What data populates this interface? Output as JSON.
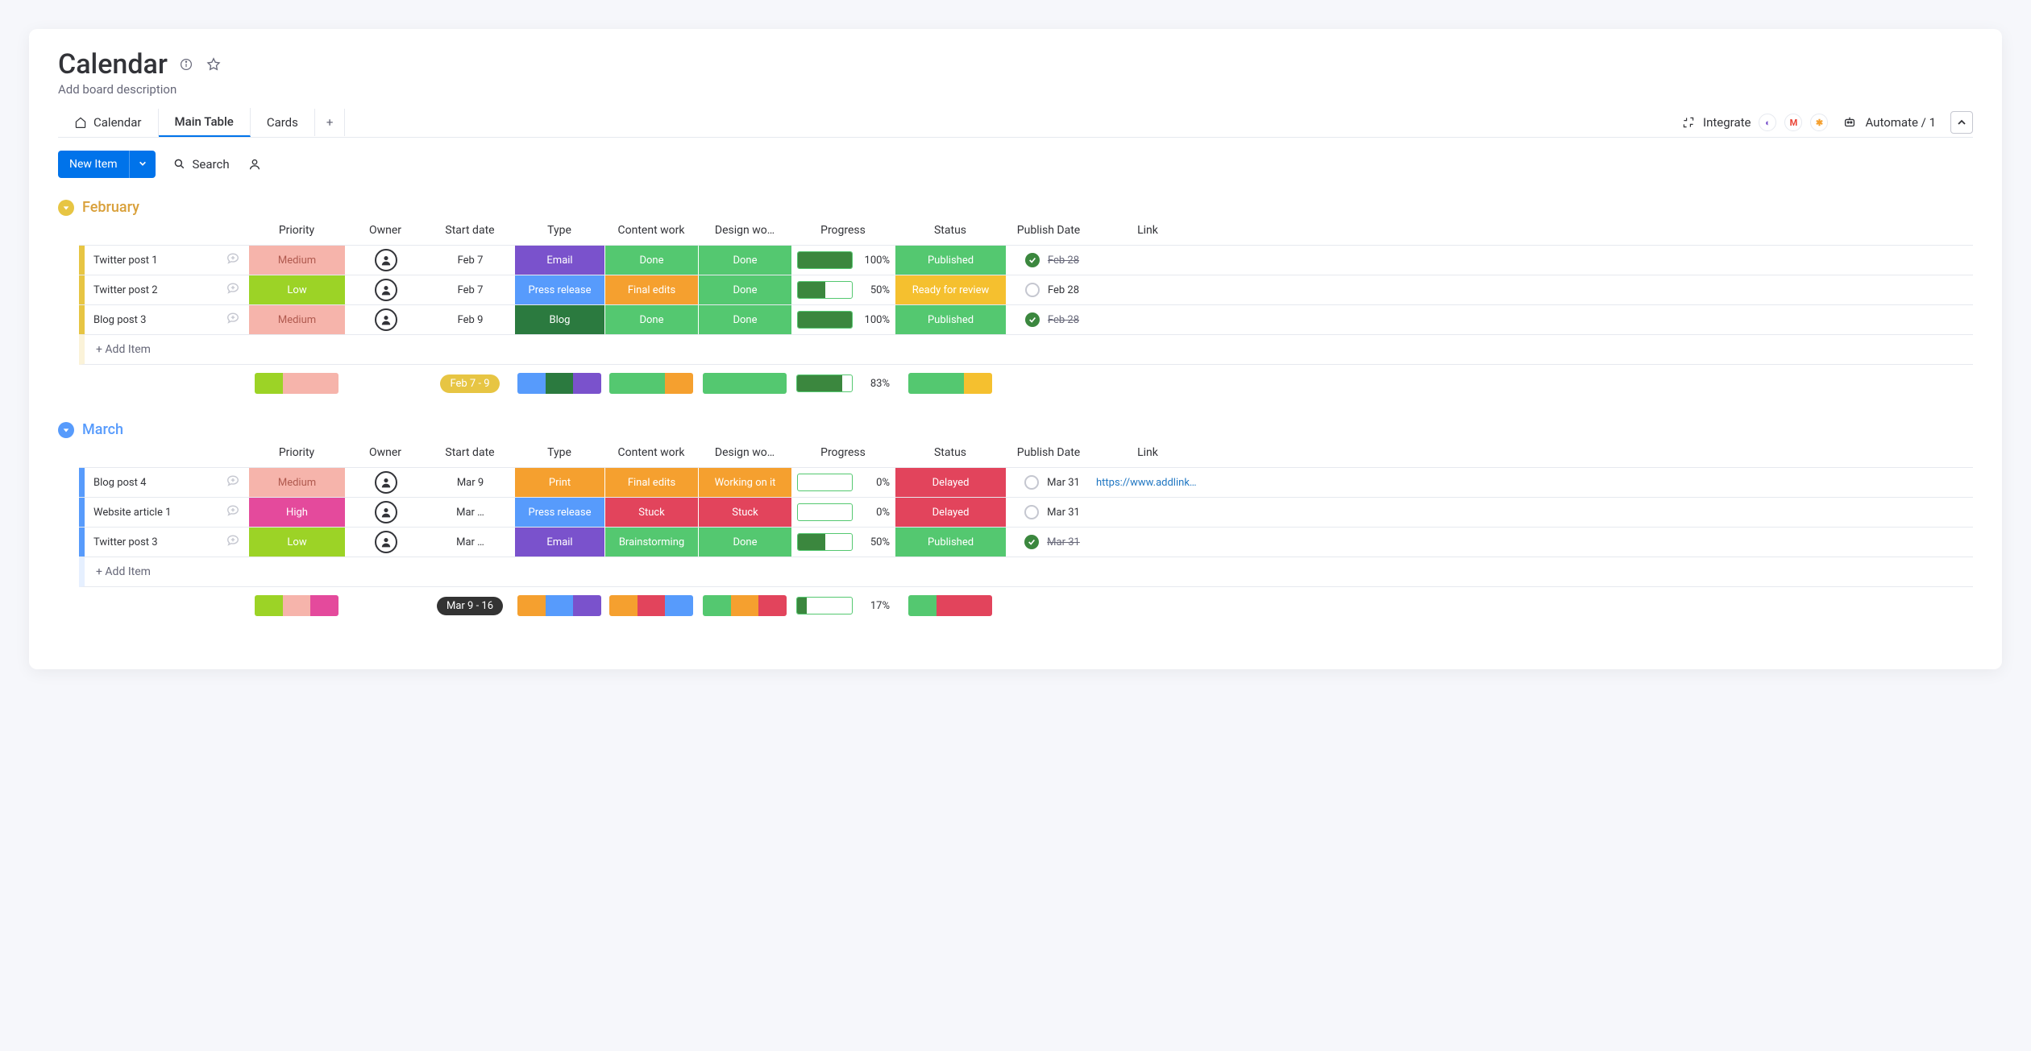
{
  "title": "Calendar",
  "description_placeholder": "Add board description",
  "tabs": {
    "calendar": "Calendar",
    "main_table": "Main Table",
    "cards": "Cards"
  },
  "integrate_label": "Integrate",
  "automate_label": "Automate / 1",
  "new_item_label": "New Item",
  "search_label": "Search",
  "add_item_label": "+ Add Item",
  "columns": {
    "priority": "Priority",
    "owner": "Owner",
    "start_date": "Start date",
    "type": "Type",
    "content_work": "Content work",
    "design_work": "Design wo…",
    "progress": "Progress",
    "status": "Status",
    "publish_date": "Publish Date",
    "link": "Link"
  },
  "colors": {
    "medium": "#f6b4ab",
    "low": "#9cd326",
    "high": "#e44a9c",
    "email": "#7a52cc",
    "press_release": "#579bfc",
    "blog": "#2b7a3f",
    "print": "#f5a02f",
    "done": "#54c870",
    "final_edits": "#f5a02f",
    "stuck": "#e2445c",
    "working": "#f5a02f",
    "brainstorm": "#54c870",
    "published": "#54c870",
    "ready": "#f5c02f",
    "delayed": "#e2445c",
    "feb_stripe": "#e7c543",
    "feb_title": "#d9a03a",
    "mar_stripe": "#579bfc",
    "mar_title": "#579bfc",
    "check_done": "#3b873e",
    "check_pending": "#c5c7d0"
  },
  "groups": [
    {
      "id": "feb",
      "name": "February",
      "summary": {
        "date_range": "Feb 7 - 9",
        "progress": "83%"
      },
      "rows": [
        {
          "name": "Twitter post 1",
          "priority": "Medium",
          "start": "Feb 7",
          "type": "Email",
          "content": "Done",
          "design": "Done",
          "progress_pct": 100,
          "progress_txt": "100%",
          "status": "Published",
          "pub": "Feb 28",
          "done": true,
          "link": ""
        },
        {
          "name": "Twitter post 2",
          "priority": "Low",
          "start": "Feb 7",
          "type": "Press release",
          "content": "Final edits",
          "design": "Done",
          "progress_pct": 50,
          "progress_txt": "50%",
          "status": "Ready for review",
          "pub": "Feb 28",
          "done": false,
          "link": ""
        },
        {
          "name": "Blog post 3",
          "priority": "Medium",
          "start": "Feb 9",
          "type": "Blog",
          "content": "Done",
          "design": "Done",
          "progress_pct": 100,
          "progress_txt": "100%",
          "status": "Published",
          "pub": "Feb 28",
          "done": true,
          "link": ""
        }
      ]
    },
    {
      "id": "mar",
      "name": "March",
      "summary": {
        "date_range": "Mar 9 - 16",
        "progress": "17%"
      },
      "rows": [
        {
          "name": "Blog post 4",
          "priority": "Medium",
          "start": "Mar 9",
          "type": "Print",
          "content": "Final edits",
          "design": "Working on it",
          "progress_pct": 0,
          "progress_txt": "0%",
          "status": "Delayed",
          "pub": "Mar 31",
          "done": false,
          "link": "https://www.addlink…"
        },
        {
          "name": "Website article 1",
          "priority": "High",
          "start": "Mar …",
          "type": "Press release",
          "content": "Stuck",
          "design": "Stuck",
          "progress_pct": 0,
          "progress_txt": "0%",
          "status": "Delayed",
          "pub": "Mar 31",
          "done": false,
          "link": ""
        },
        {
          "name": "Twitter post 3",
          "priority": "Low",
          "start": "Mar …",
          "type": "Email",
          "content": "Brainstorming",
          "design": "Done",
          "progress_pct": 50,
          "progress_txt": "50%",
          "status": "Published",
          "pub": "Mar 31",
          "done": true,
          "link": ""
        }
      ]
    }
  ]
}
